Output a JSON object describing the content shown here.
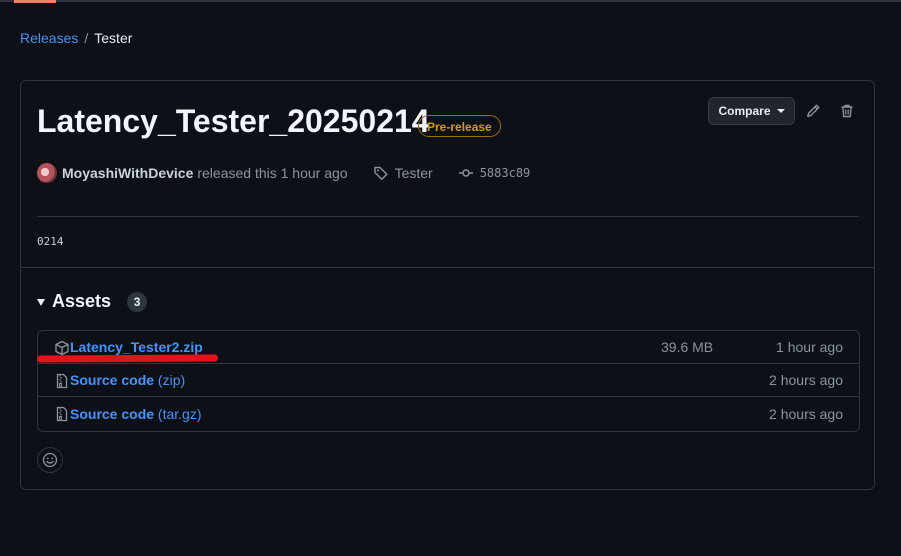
{
  "breadcrumb": {
    "parent": "Releases",
    "separator": "/",
    "current": "Tester"
  },
  "release": {
    "title": "Latency_Tester_20250214",
    "badge": "Pre-release",
    "compare_label": "Compare",
    "author": "MoyashiWithDevice",
    "released_text": "released this 1 hour ago",
    "tag": "Tester",
    "commit": "5883c89",
    "body": "0214"
  },
  "assets": {
    "heading": "Assets",
    "count": "3",
    "items": [
      {
        "name": "Latency_Tester2.zip",
        "format": "",
        "size": "39.6 MB",
        "time": "1 hour ago",
        "icon": "package-icon"
      },
      {
        "name": "Source code",
        "format": "(zip)",
        "size": "",
        "time": "2 hours ago",
        "icon": "file-zip-icon"
      },
      {
        "name": "Source code",
        "format": "(tar.gz)",
        "size": "",
        "time": "2 hours ago",
        "icon": "file-zip-icon"
      }
    ]
  },
  "colors": {
    "background": "#0d1117",
    "link": "#4493f8",
    "badge": "#d29922",
    "annotation": "#e5121e"
  }
}
